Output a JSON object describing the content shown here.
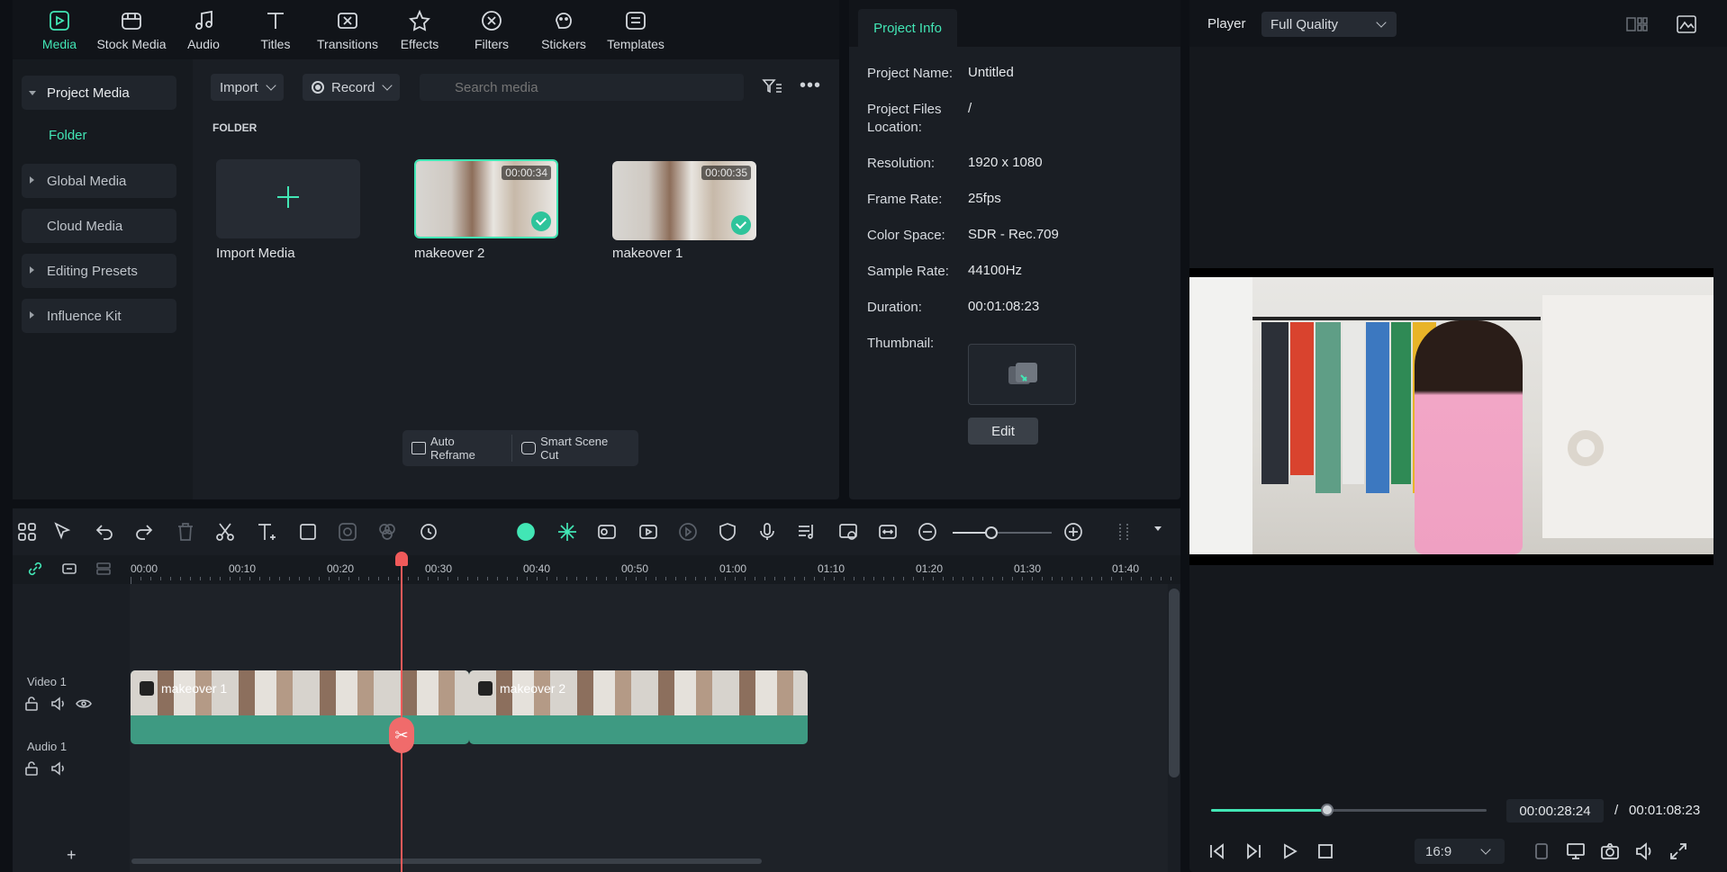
{
  "nav": {
    "tabs": [
      {
        "label": "Media",
        "icon": "media-icon",
        "active": true
      },
      {
        "label": "Stock Media",
        "icon": "stock-media-icon"
      },
      {
        "label": "Audio",
        "icon": "audio-note-icon"
      },
      {
        "label": "Titles",
        "icon": "titles-t-icon"
      },
      {
        "label": "Transitions",
        "icon": "transitions-icon"
      },
      {
        "label": "Effects",
        "icon": "effects-star-icon"
      },
      {
        "label": "Filters",
        "icon": "filters-icon"
      },
      {
        "label": "Stickers",
        "icon": "stickers-icon"
      },
      {
        "label": "Templates",
        "icon": "templates-icon"
      }
    ]
  },
  "sidebar": {
    "items": [
      {
        "label": "Project Media",
        "expanded": true
      },
      {
        "label": "Global Media"
      },
      {
        "label": "Cloud Media"
      },
      {
        "label": "Editing Presets"
      },
      {
        "label": "Influence Kit"
      }
    ],
    "folder_link": "Folder"
  },
  "media_toolbar": {
    "import_label": "Import",
    "record_label": "Record",
    "search_placeholder": "Search media"
  },
  "folder": {
    "heading": "FOLDER",
    "import_label": "Import Media",
    "clips": [
      {
        "name": "makeover 2",
        "duration": "00:00:34",
        "selected": true
      },
      {
        "name": "makeover 1",
        "duration": "00:00:35"
      }
    ]
  },
  "media_actions": {
    "auto_reframe": "Auto Reframe",
    "smart_scene_cut": "Smart Scene Cut"
  },
  "project_info": {
    "tab_label": "Project Info",
    "fields": [
      {
        "key": "Project Name:",
        "value": "Untitled"
      },
      {
        "key": "Project Files Location:",
        "value": "/"
      },
      {
        "key": "Resolution:",
        "value": "1920 x 1080"
      },
      {
        "key": "Frame Rate:",
        "value": "25fps"
      },
      {
        "key": "Color Space:",
        "value": "SDR - Rec.709"
      },
      {
        "key": "Sample Rate:",
        "value": "44100Hz"
      },
      {
        "key": "Duration:",
        "value": "00:01:08:23"
      },
      {
        "key": "Thumbnail:",
        "value": ""
      }
    ],
    "edit_label": "Edit"
  },
  "player": {
    "label": "Player",
    "quality": "Full Quality",
    "current_time": "00:00:28:24",
    "separator": "/",
    "total_time": "00:01:08:23",
    "progress": 0.42,
    "ratio": "16:9"
  },
  "timeline": {
    "ruler": [
      "00:00",
      "00:10",
      "00:20",
      "00:30",
      "00:40",
      "00:50",
      "01:00",
      "01:10",
      "01:20",
      "01:30",
      "01:40"
    ],
    "tracks": [
      {
        "label": "Video 1"
      },
      {
        "label": "Audio 1"
      }
    ],
    "clips": [
      {
        "name": "makeover 1"
      },
      {
        "name": "makeover 2"
      }
    ],
    "add_track": "+"
  },
  "colors": {
    "accent": "#42e6b5",
    "clip": "#3e9a82",
    "playhead": "#f05a5a"
  }
}
